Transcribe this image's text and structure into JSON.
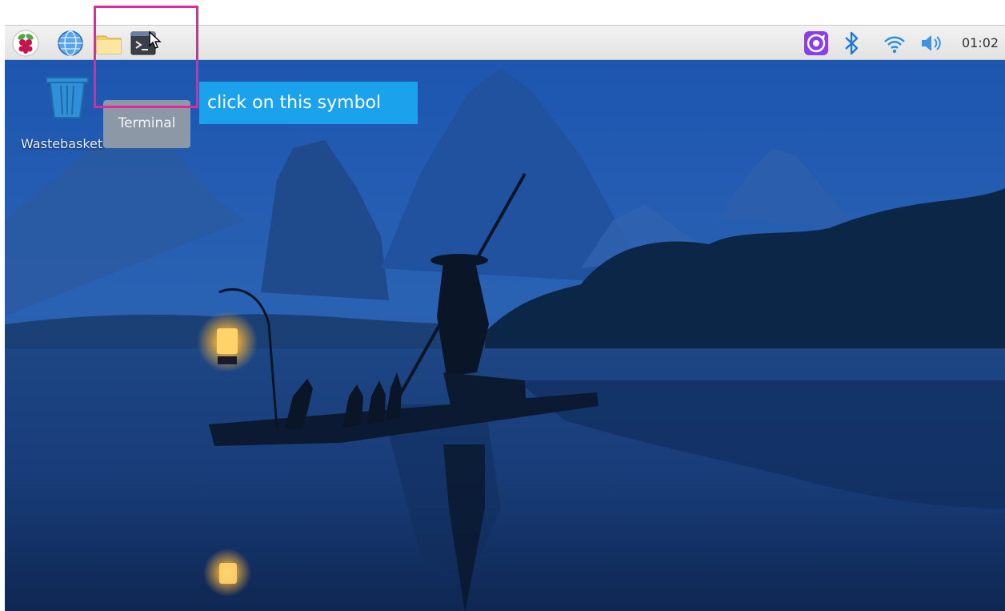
{
  "taskbar": {
    "launchers": [
      {
        "icon": "raspberry-menu-icon"
      },
      {
        "icon": "web-browser-globe-icon"
      },
      {
        "icon": "file-manager-folder-icon"
      },
      {
        "icon": "terminal-icon"
      }
    ],
    "tray": {
      "icons": [
        "app-update-icon",
        "bluetooth-icon",
        "wifi-icon",
        "volume-icon"
      ],
      "clock": "01:02"
    }
  },
  "desktop": {
    "icons": [
      {
        "label": "Wastebasket",
        "icon": "wastebasket-icon"
      }
    ],
    "tooltip": "Terminal"
  },
  "annotation": {
    "callout": "click on this symbol",
    "highlight_color": "#e6269b",
    "callout_color": "#1aa3ec"
  },
  "colors": {
    "taskbar": "#ececec",
    "wallpaper_sky": "#1c4a9c",
    "bluetooth": "#1e7ad6",
    "wifi": "#2d8ee0",
    "update_badge": "#8b3ee8"
  }
}
